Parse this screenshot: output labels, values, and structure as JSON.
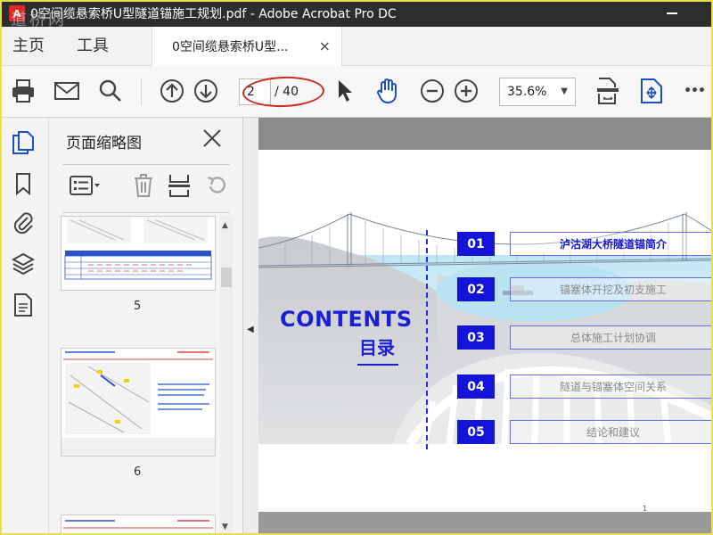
{
  "window": {
    "title": "0空间缆悬索桥U型隧道锚施工规划.pdf - Adobe Acrobat Pro DC",
    "app_icon": "acrobat-icon",
    "watermark": "道桥网"
  },
  "tabs": {
    "home": "主页",
    "tools": "工具",
    "document": "0空间缆悬索桥U型...",
    "close_symbol": "×"
  },
  "toolbar": {
    "current_page": "2",
    "total_pages": "/ 40",
    "zoom": "35.6%",
    "zoom_caret": "▼",
    "more_symbol": "•••"
  },
  "annotation": {
    "color": "#d12a1c",
    "shape": "ellipse around page number"
  },
  "panel": {
    "title": "页面缩略图",
    "thumbnails": [
      {
        "page": "5"
      },
      {
        "page": "6"
      }
    ]
  },
  "document": {
    "contents_title": "CONTENTS",
    "contents_subtitle": "目录",
    "page_number": "1",
    "accent_color": "#1414d8",
    "toc": [
      {
        "num": "01",
        "label": "泸沽湖大桥隧道锚简介",
        "active": true
      },
      {
        "num": "02",
        "label": "锚塞体开挖及初支施工",
        "active": false
      },
      {
        "num": "03",
        "label": "总体施工计划协调",
        "active": false
      },
      {
        "num": "04",
        "label": "隧道与锚塞体空间关系",
        "active": false
      },
      {
        "num": "05",
        "label": "结论和建议",
        "active": false
      }
    ]
  }
}
